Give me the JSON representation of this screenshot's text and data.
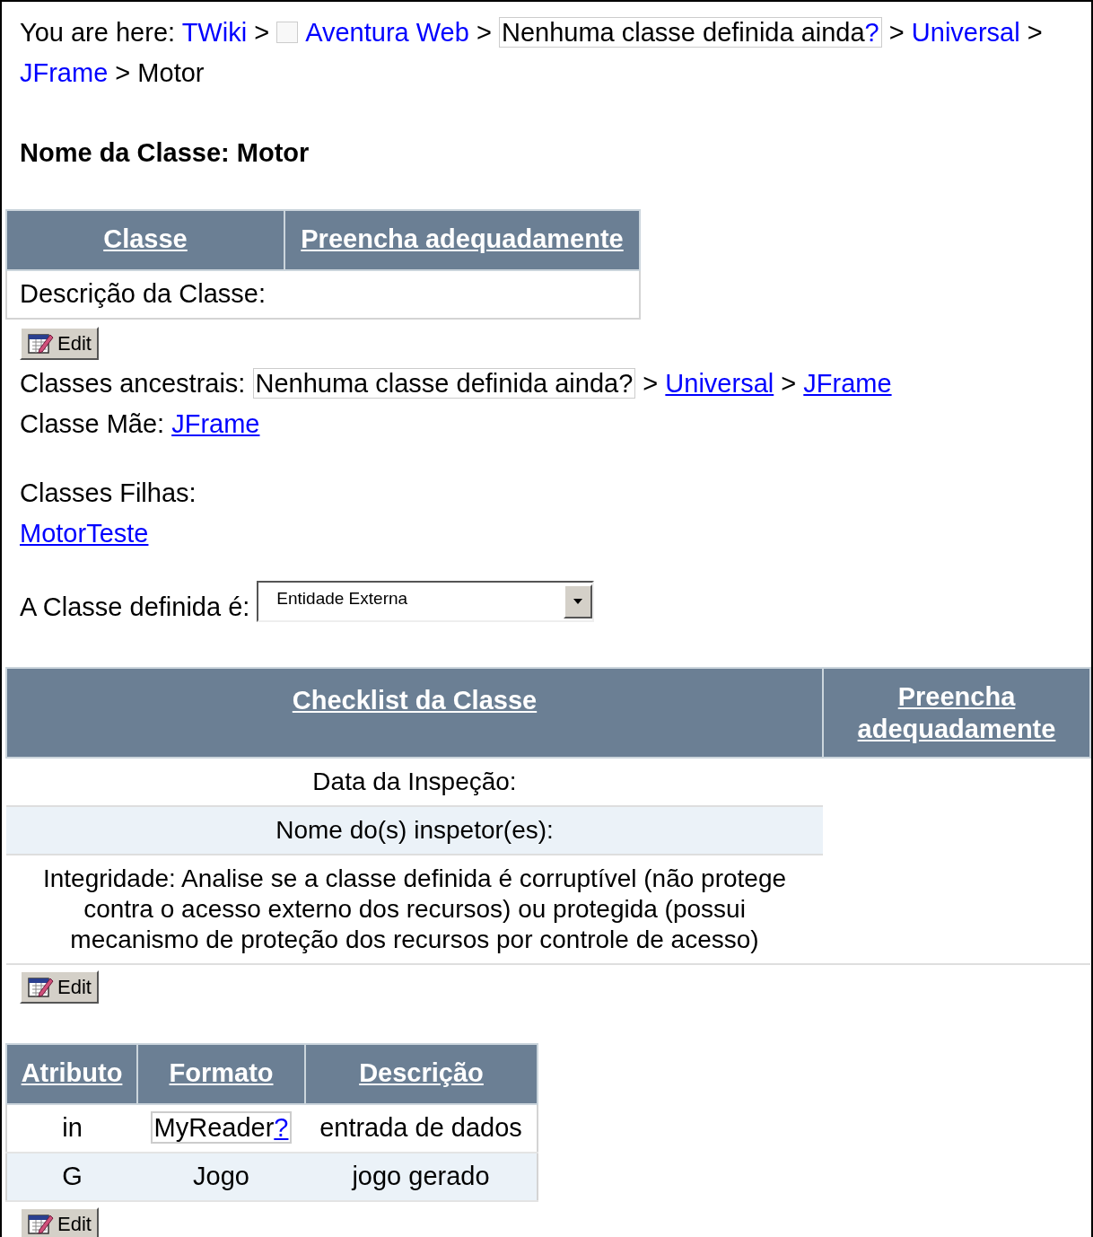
{
  "breadcrumb": {
    "label": "You are here:",
    "items": [
      {
        "kind": "link",
        "text": "TWiki",
        "separator": ">"
      },
      {
        "kind": "web",
        "text": "Aventura Web",
        "separator": ">"
      },
      {
        "kind": "missing",
        "text": "Nenhuma classe definida ainda",
        "mark": "?",
        "separator": ">"
      },
      {
        "kind": "link",
        "text": "Universal",
        "separator": ">"
      },
      {
        "kind": "link",
        "text": "JFrame",
        "separator": ">"
      },
      {
        "kind": "current",
        "text": "Motor"
      }
    ]
  },
  "heading": "Nome da Classe: Motor",
  "class_table": {
    "columns": [
      "Classe",
      "Preencha adequadamente"
    ],
    "rows": [
      {
        "label": "Descrição da Classe:"
      }
    ]
  },
  "class_edit": {
    "label": "Edit"
  },
  "ancestors": {
    "label": "Classes ancestrais:",
    "items": [
      {
        "kind": "missing",
        "text": "Nenhuma classe definida ainda",
        "mark": "?",
        "separator": ">"
      },
      {
        "kind": "link",
        "text": "Universal",
        "separator": ">"
      },
      {
        "kind": "link",
        "text": "JFrame"
      }
    ]
  },
  "parent": {
    "label": "Classe Mãe:",
    "link": "JFrame"
  },
  "children": {
    "label": "Classes Filhas:",
    "items": [
      "MotorTeste"
    ]
  },
  "classification": {
    "label": "A Classe definida é:",
    "value": "Entidade Externa"
  },
  "checklist": {
    "columns": [
      "Checklist da Classe",
      "Preencha adequadamente"
    ],
    "rows": [
      {
        "text": "Data da Inspeção:"
      },
      {
        "text": "Nome do(s) inspetor(es):"
      },
      {
        "text": "Integridade: Analise se a classe definida é corruptível (não protege contra o acesso externo dos recursos) ou protegida (possui mecanismo de proteção dos recursos por controle de acesso)"
      }
    ]
  },
  "checklist_edit": {
    "label": "Edit"
  },
  "attributes": {
    "columns": [
      "Atributo",
      "Formato",
      "Descrição"
    ],
    "rows": [
      {
        "cells": [
          {
            "kind": "plain",
            "text": "in"
          },
          {
            "kind": "missing",
            "text": "MyReader",
            "mark": "?"
          },
          {
            "kind": "plain",
            "text": "entrada de dados"
          }
        ]
      },
      {
        "cells": [
          {
            "kind": "plain",
            "text": "G"
          },
          {
            "kind": "plain",
            "text": "Jogo"
          },
          {
            "kind": "plain",
            "text": "jogo gerado"
          }
        ]
      }
    ]
  },
  "attributes_edit": {
    "label": "Edit"
  }
}
